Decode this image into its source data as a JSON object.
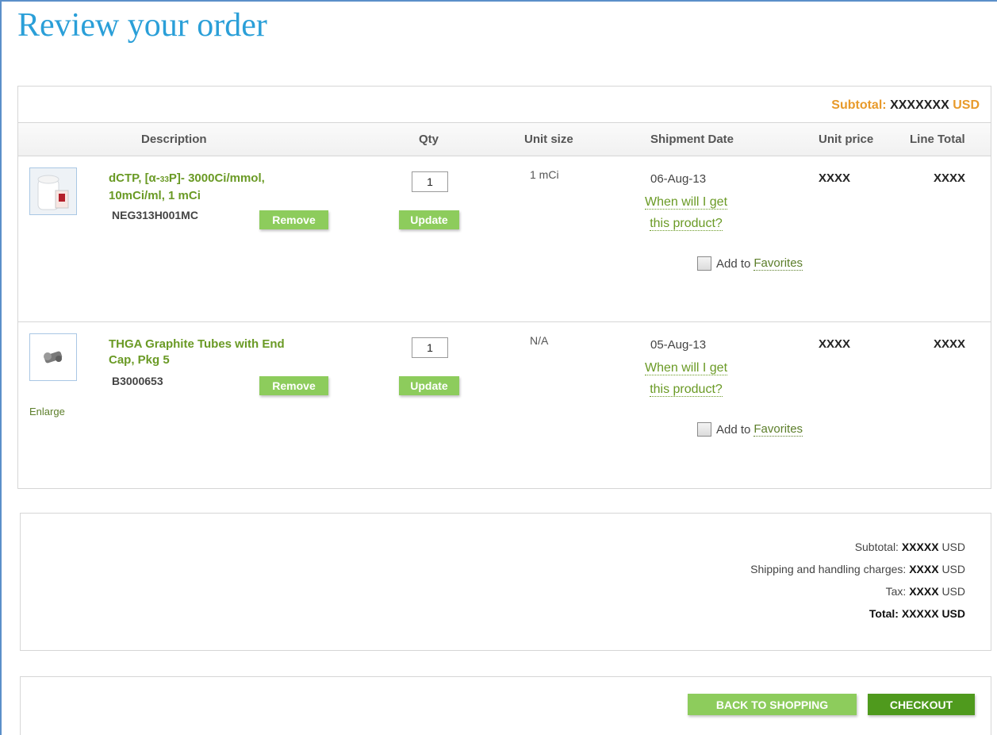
{
  "page": {
    "title": "Review your order"
  },
  "cart": {
    "subtotal_label": "Subtotal:",
    "subtotal_value": "XXXXXXX",
    "subtotal_currency": "USD",
    "columns": {
      "description": "Description",
      "qty": "Qty",
      "unit_size": "Unit size",
      "shipment_date": "Shipment Date",
      "unit_price": "Unit price",
      "line_total": "Line Total"
    },
    "items": [
      {
        "name_line1": "dCTP, [α-",
        "isotope": "33",
        "name_line1_rest": "P]- 3000Ci/mmol,",
        "name_line2": "10mCi/ml, 1 mCi",
        "sku": "NEG313H001MC",
        "qty": "1",
        "unit_size": "1 mCi",
        "shipment_date": "06-Aug-13",
        "when_line1": "When will I get",
        "when_line2": "this product?",
        "unit_price": "XXXX",
        "line_total": "XXXX",
        "remove_label": "Remove",
        "update_label": "Update",
        "fav_prefix": "Add to",
        "fav_link": "Favorites"
      },
      {
        "name_line1": "THGA Graphite Tubes with End",
        "name_line2": "Cap, Pkg 5",
        "sku": "B3000653",
        "enlarge_label": "Enlarge",
        "qty": "1",
        "unit_size": "N/A",
        "shipment_date": "05-Aug-13",
        "when_line1": "When will I get",
        "when_line2": "this product?",
        "unit_price": "XXXX",
        "line_total": "XXXX",
        "remove_label": "Remove",
        "update_label": "Update",
        "fav_prefix": "Add to",
        "fav_link": "Favorites"
      }
    ]
  },
  "summary": {
    "subtotal_label": "Subtotal:",
    "subtotal_value": "XXXXX",
    "shipping_label": "Shipping and handling charges:",
    "shipping_value": "XXXX",
    "tax_label": "Tax:",
    "tax_value": "XXXX",
    "total_label": "Total:",
    "total_value": "XXXXX",
    "currency": "USD"
  },
  "actions": {
    "back_label": "BACK TO SHOPPING",
    "checkout_label": "CHECKOUT"
  },
  "colors": {
    "title_blue": "#2a9fd8",
    "link_green": "#6a9a25",
    "button_light_green": "#8dcc5c",
    "button_dark_green": "#4f9a1d",
    "subtotal_orange": "#e89a2a"
  }
}
